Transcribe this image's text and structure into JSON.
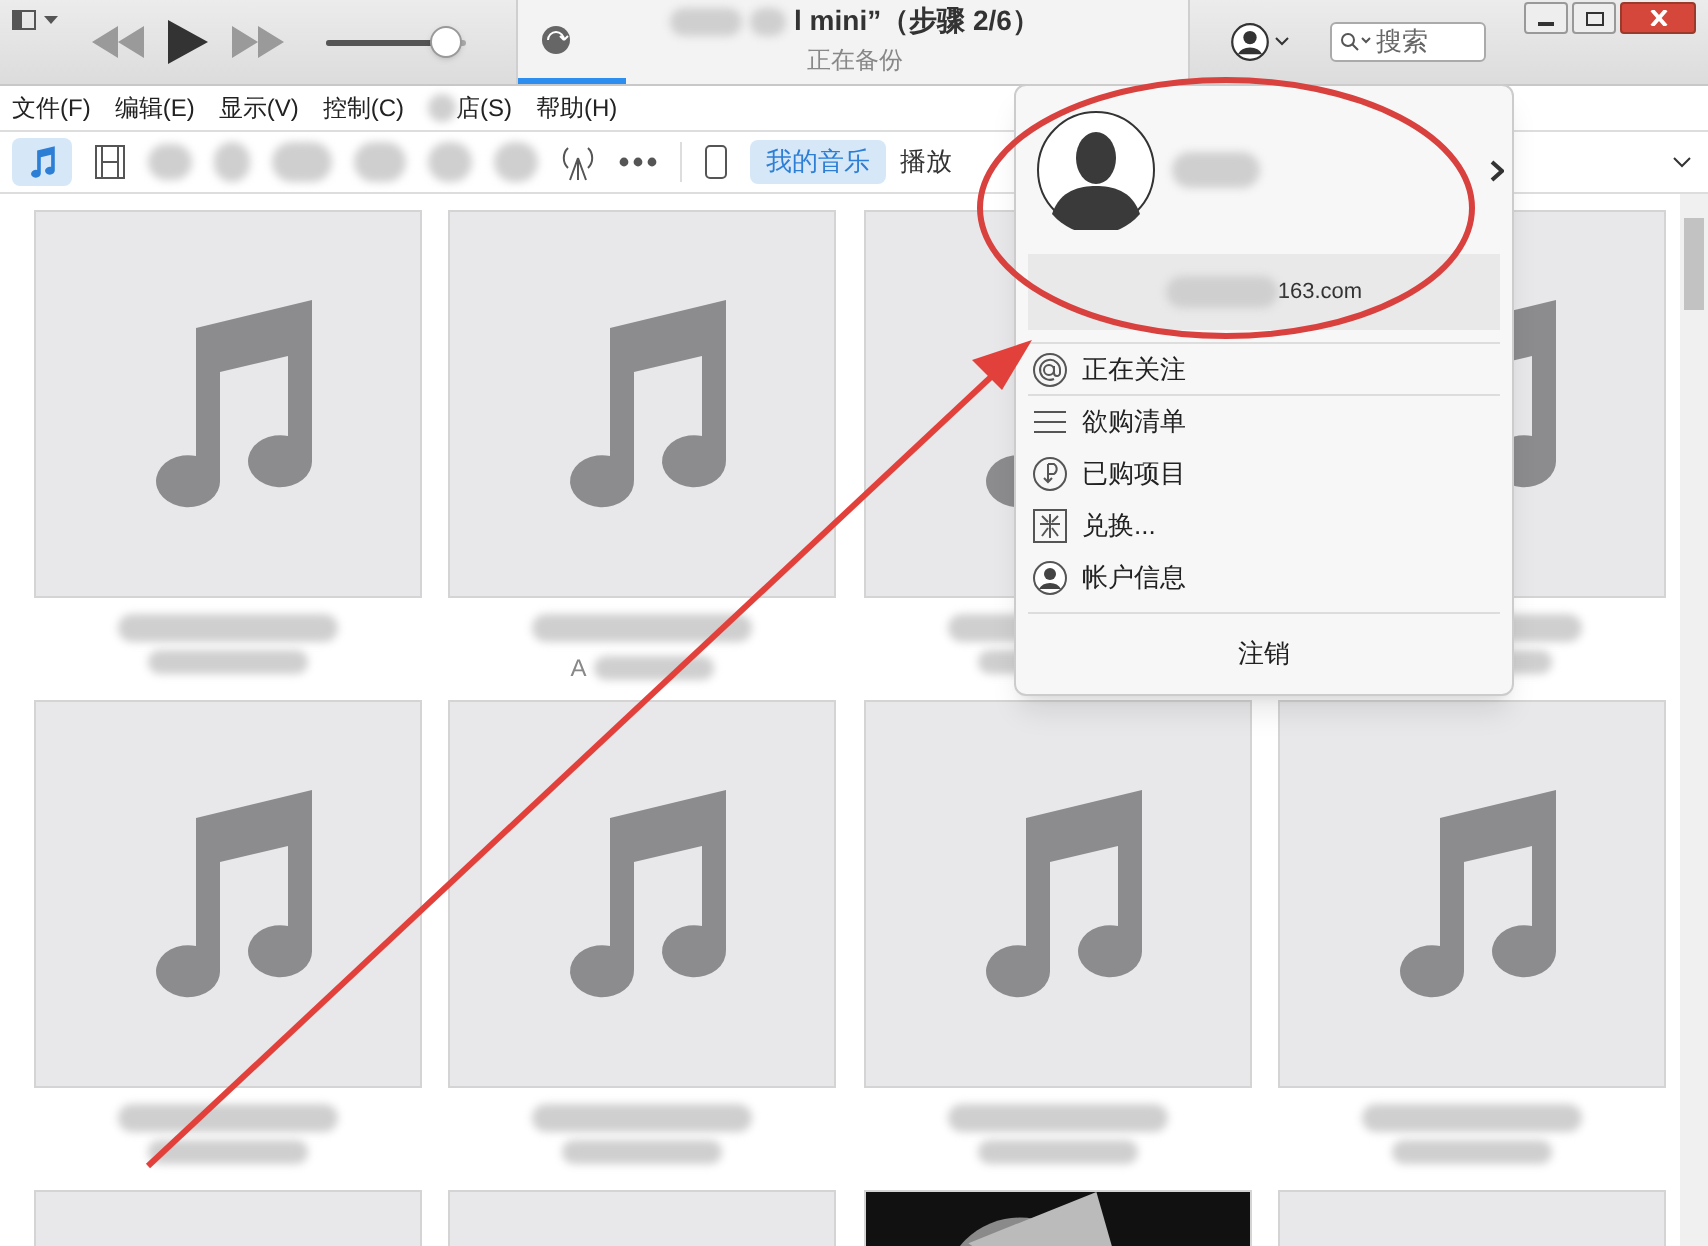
{
  "player": {
    "title": "l mini”（步骤 2/6）",
    "status": "正在备份",
    "progress": {
      "level": 0.16
    },
    "volume": {
      "level": 0.85
    }
  },
  "search": {
    "placeholder": "搜索"
  },
  "menu_bar": [
    "文件(F)",
    "编辑(E)",
    "显示(V)",
    "控制(C)",
    "店(S)",
    "帮助(H)"
  ],
  "view_tabs": [
    {
      "label": "我的音乐",
      "selected": true
    },
    {
      "label": "播放",
      "selected": false
    }
  ],
  "albums": [
    {
      "kind": "music"
    },
    {
      "kind": "music",
      "caption": "A"
    },
    {
      "kind": "music"
    },
    {
      "kind": "music"
    },
    {
      "kind": "music"
    },
    {
      "kind": "music"
    },
    {
      "kind": "music"
    },
    {
      "kind": "music"
    },
    {
      "kind": "music"
    },
    {
      "kind": "music"
    },
    {
      "kind": "picture"
    },
    {
      "kind": "music"
    }
  ],
  "account_menu": {
    "email": "163.com",
    "items": [
      {
        "kind": "at",
        "label": "正在关注"
      },
      {
        "kind": "list",
        "label": "欲购清单"
      },
      {
        "kind": "purchased",
        "label": "已购项目"
      },
      {
        "kind": "redeem",
        "label": "兑换..."
      },
      {
        "kind": "account",
        "label": "帐户信息"
      }
    ],
    "sign_out": "注销"
  }
}
